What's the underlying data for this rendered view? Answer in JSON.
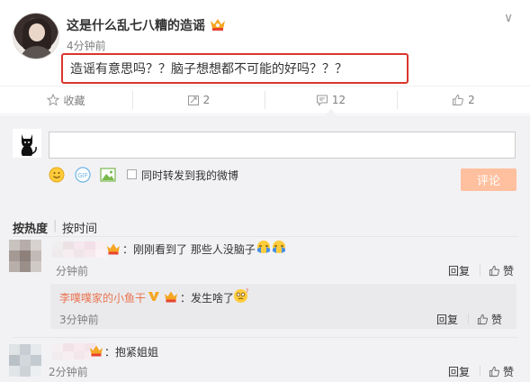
{
  "post": {
    "username": "这是什么乱七八糟的造谣",
    "time": "4分钟前",
    "text": "造谣有意思吗？？脑子想想都不可能的好吗？？？"
  },
  "actions": {
    "collect": "收藏",
    "repost": "2",
    "comment": "12",
    "like": "2"
  },
  "composer": {
    "repost_label": "同时转发到我的微博",
    "submit": "评论"
  },
  "sort": {
    "hot": "按热度",
    "time": "按时间"
  },
  "comments": [
    {
      "text": "：刚刚看到了 那些人没脑子",
      "time": "分钟前",
      "reply_label": "回复",
      "like_label": "赞",
      "reply": {
        "name": "李噗噗家的小鱼干",
        "text": "：发生啥了",
        "time": "3分钟前",
        "reply_label": "回复",
        "like_label": "赞"
      }
    },
    {
      "text": "：抱紧姐姐",
      "time": "2分钟前",
      "reply_label": "回复",
      "like_label": "赞"
    }
  ],
  "colors": {
    "highlight_border": "#d9362b",
    "submit_bg": "#ffc09f",
    "reply_name": "#eb7350",
    "panel_bg": "#f2f2f5"
  }
}
